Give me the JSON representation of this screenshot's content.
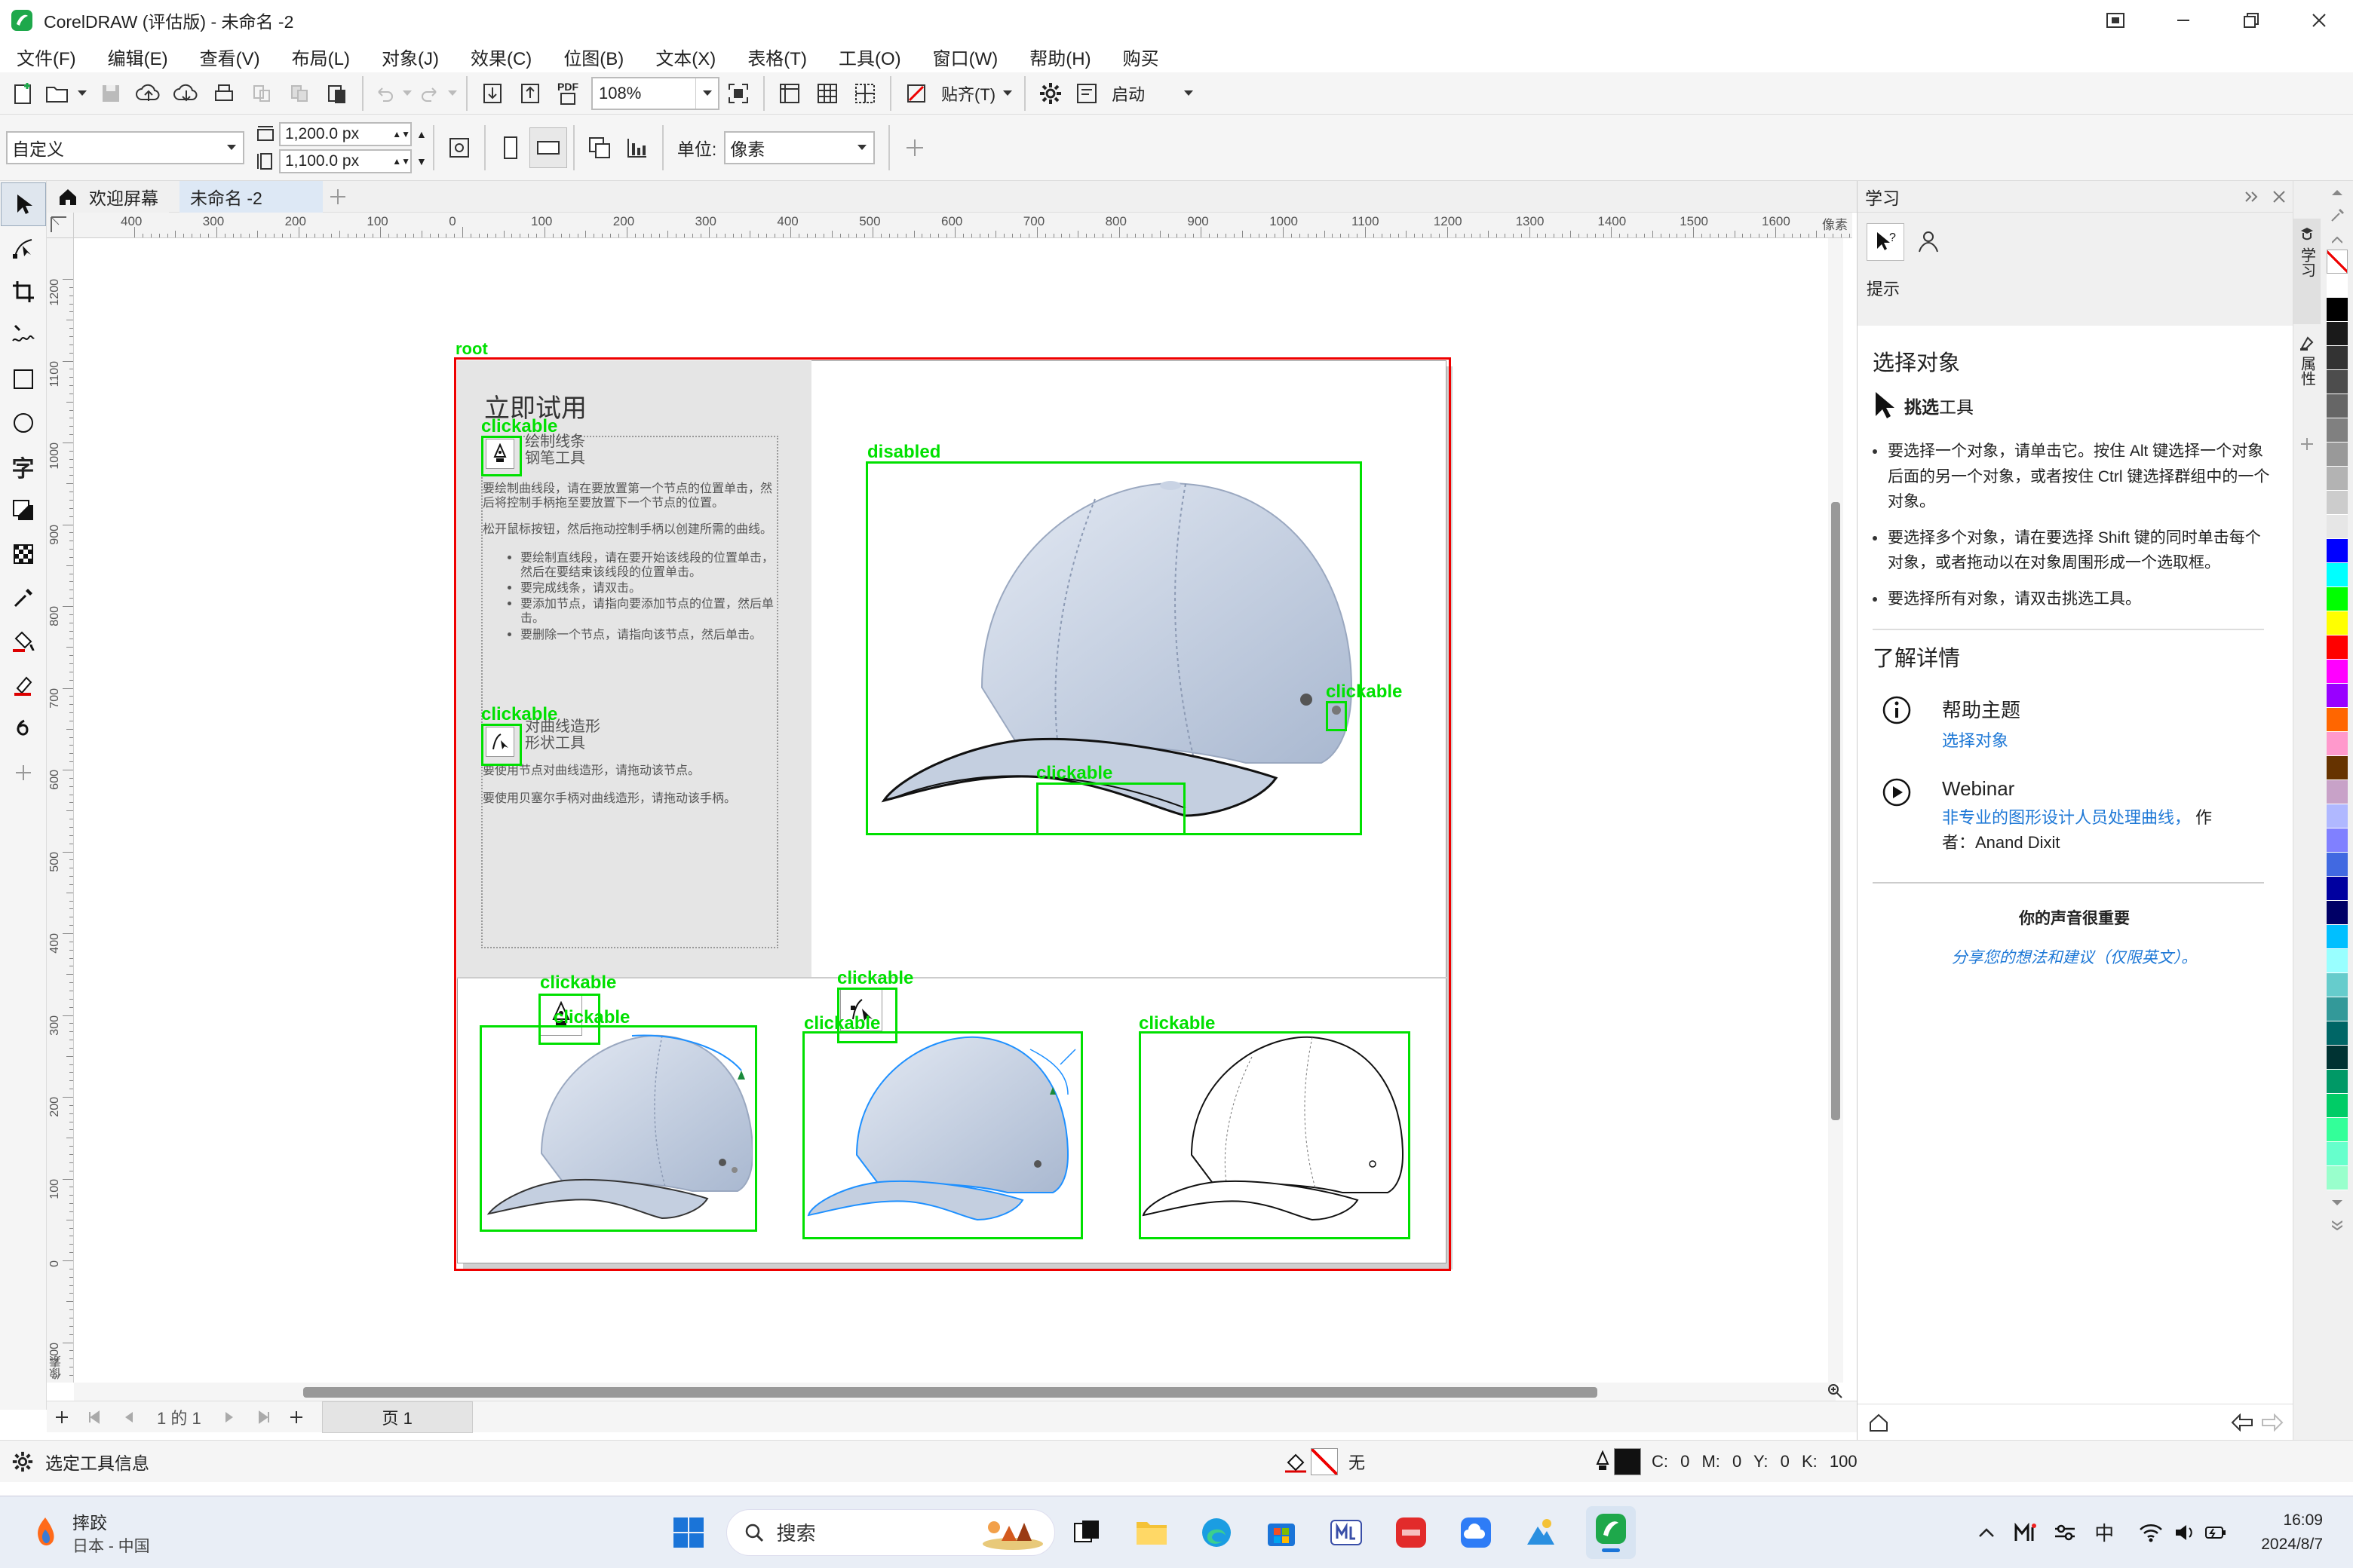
{
  "title_bar": {
    "title": "CorelDRAW (评估版) - 未命名 -2"
  },
  "menu": [
    "文件(F)",
    "编辑(E)",
    "查看(V)",
    "布局(L)",
    "对象(J)",
    "效果(C)",
    "位图(B)",
    "文本(X)",
    "表格(T)",
    "工具(O)",
    "窗口(W)",
    "帮助(H)",
    "购买"
  ],
  "toolbar": {
    "pdf_label": "PDF",
    "zoom": "108%",
    "snap_label": "贴齐(T)",
    "launch_label": "启动"
  },
  "propbar": {
    "preset": "自定义",
    "width": "1,200.0 px",
    "height": "1,100.0 px",
    "unit_label": "单位:",
    "unit_value": "像素"
  },
  "tabs": {
    "welcome": "欢迎屏幕",
    "doc": "未命名 -2"
  },
  "ruler": {
    "h_ticks": [
      "400",
      "300",
      "200",
      "100",
      "0",
      "100",
      "200",
      "300",
      "400",
      "500",
      "600",
      "700",
      "800",
      "900",
      "1000",
      "1100",
      "1200",
      "1300",
      "1400",
      "1500",
      "1600"
    ],
    "h_unit": "像素",
    "v_ticks": [
      "1200",
      "1100",
      "1000",
      "900",
      "800",
      "700",
      "600",
      "500",
      "400",
      "300",
      "200",
      "100",
      "0",
      "100"
    ],
    "v_unit": "像素"
  },
  "document": {
    "heading": "立即试用",
    "pen_title_1": "绘制线条",
    "pen_title_2": "钢笔工具",
    "pen_para_1": "要绘制曲线段，请在要放置第一个节点的位置单击，然后将控制手柄拖至要放置下一个节点的位置。",
    "pen_para_2": "松开鼠标按钮，然后拖动控制手柄以创建所需的曲线。",
    "pen_bullets": [
      "要绘制直线段，请在要开始该线段的位置单击，然后在要结束该线段的位置单击。",
      "要完成线条，请双击。",
      "要添加节点，请指向要添加节点的位置，然后单击。",
      "要删除一个节点，请指向该节点，然后单击。"
    ],
    "shape_title_1": "对曲线造形",
    "shape_title_2": "形状工具",
    "shape_para_1": "要使用节点对曲线造形，请拖动该节点。",
    "shape_para_2": "要使用贝塞尔手柄对曲线造形，请拖动该手柄。"
  },
  "overlay_labels": {
    "root": "root",
    "clickable": "clickable",
    "disabled": "disabled"
  },
  "status": {
    "page_nav": "1 的 1",
    "page_tab": "页 1",
    "tool_info": "选定工具信息",
    "fill_none": "无",
    "cmyk": "C: 0 M: 0 Y: 0 K: 100"
  },
  "learn_panel": {
    "title": "学习",
    "hints_label": "提示",
    "section_title": "选择对象",
    "tool_name_bold": "挑选",
    "tool_name_rest": "工具",
    "bullets": [
      "要选择一个对象，请单击它。按住 Alt 键选择一个对象后面的另一个对象，或者按住 Ctrl 键选择群组中的一个对象。",
      "要选择多个对象，请在要选择 Shift 键的同时单击每个对象，或者拖动以在对象周围形成一个选取框。",
      "要选择所有对象，请双击挑选工具。"
    ],
    "learn_more": "了解详情",
    "help_title": "帮助主题",
    "help_link": "选择对象",
    "webinar_title": "Webinar",
    "webinar_link": "非专业的图形设计人员处理曲线，",
    "webinar_author_pre": "作",
    "webinar_author": "者：Anand Dixit",
    "feedback_title": "你的声音很重要",
    "feedback_link": "分享您的想法和建议（仅限英文）。"
  },
  "docker_tabs": [
    "学习",
    "属性"
  ],
  "palette_colors": [
    "#ffffff",
    "#000000",
    "#1a1a1a",
    "#333333",
    "#4d4d4d",
    "#666666",
    "#808080",
    "#999999",
    "#b3b3b3",
    "#cccccc",
    "#e6e6e6",
    "#0000ff",
    "#00ffff",
    "#00ff00",
    "#ffff00",
    "#ff0000",
    "#ff00ff",
    "#9900ff",
    "#ff6600",
    "#ff99cc",
    "#663300",
    "#c8a2c8",
    "#b0b8ff",
    "#8080ff",
    "#4169e1",
    "#0000a0",
    "#000066",
    "#00bfff",
    "#99ffff",
    "#66cccc",
    "#339999",
    "#006666",
    "#003333",
    "#009966",
    "#00cc66",
    "#33ff99",
    "#66ffcc",
    "#99ffcc"
  ],
  "taskbar": {
    "weather_title": "摔跤",
    "weather_sub": "日本 - 中国",
    "search_placeholder": "搜索",
    "ime": "中",
    "time": "16:09",
    "date": "2024/8/7"
  }
}
